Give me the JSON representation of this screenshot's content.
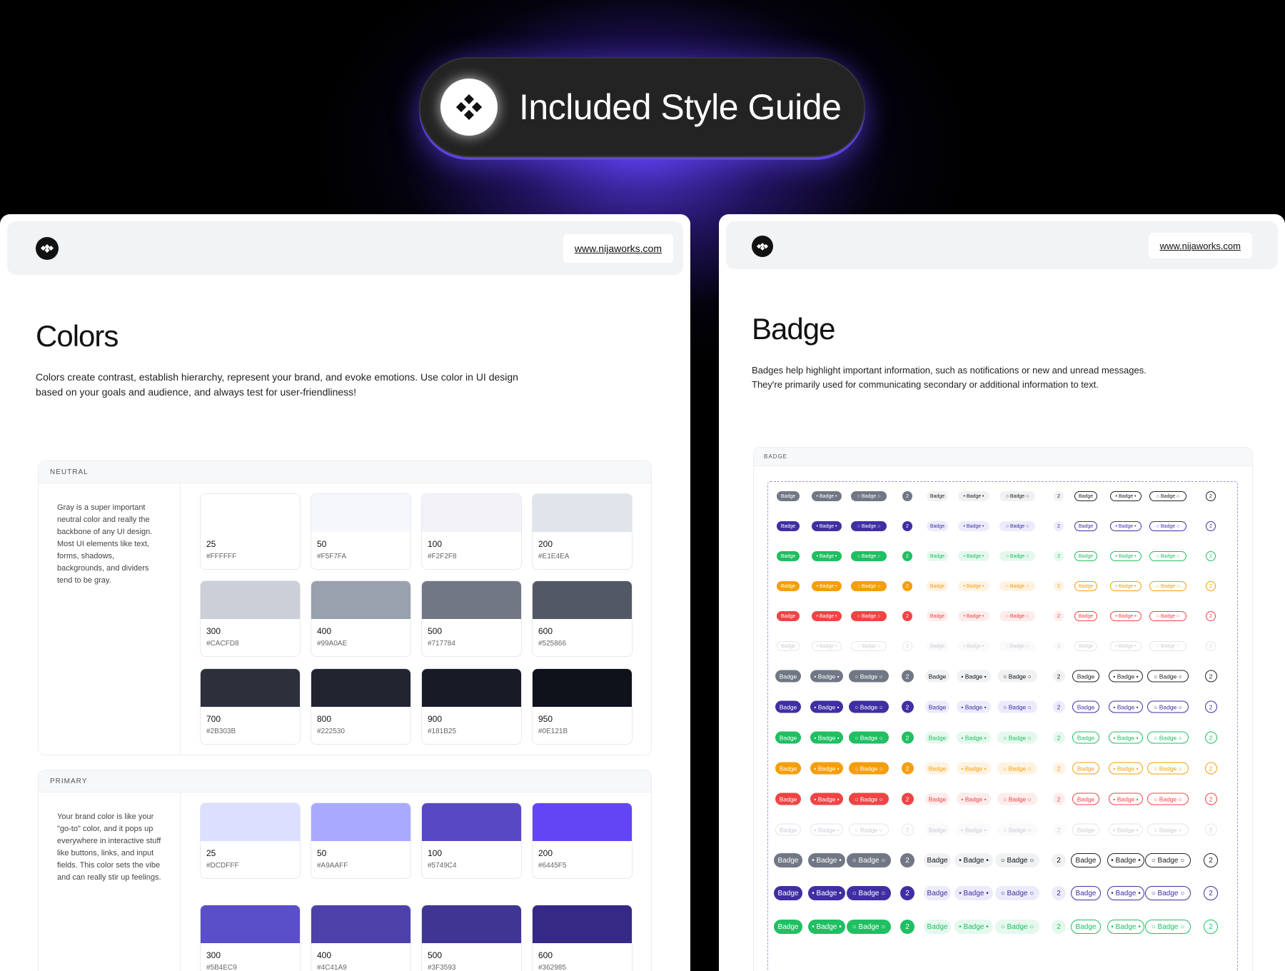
{
  "hero": {
    "title": "Included Style Guide"
  },
  "colors_card": {
    "url": "www.nijaworks.com",
    "title": "Colors",
    "description_line1": "Colors create contrast, establish hierarchy, represent your brand, and evoke emotions. Use color in UI design",
    "description_line2": "based on your goals and audience, and always test for user-friendliness!",
    "panels": [
      {
        "label": "NEUTRAL",
        "description": "Gray is a super important neutral color and really the backbone of any UI design. Most UI elements like text, forms, shadows, backgrounds, and dividers tend to be gray.",
        "swatches": [
          {
            "shade": "25",
            "hex": "#FFFFFF"
          },
          {
            "shade": "50",
            "hex": "#F5F7FA"
          },
          {
            "shade": "100",
            "hex": "#F2F2F8"
          },
          {
            "shade": "200",
            "hex": "#E1E4EA"
          },
          {
            "shade": "300",
            "hex": "#CACFD8"
          },
          {
            "shade": "400",
            "hex": "#99A0AE"
          },
          {
            "shade": "500",
            "hex": "#717784"
          },
          {
            "shade": "600",
            "hex": "#525866"
          },
          {
            "shade": "700",
            "hex": "#2B303B"
          },
          {
            "shade": "800",
            "hex": "#222530"
          },
          {
            "shade": "900",
            "hex": "#181B25"
          },
          {
            "shade": "950",
            "hex": "#0E121B"
          }
        ]
      },
      {
        "label": "PRIMARY",
        "description": "Your brand color is like your \"go-to\" color, and it pops up everywhere in interactive stuff like buttons, links, and input fields. This color sets the vibe and can really stir up feelings.",
        "swatches": [
          {
            "shade": "25",
            "hex": "#DCDFFF"
          },
          {
            "shade": "50",
            "hex": "#A9AAFF"
          },
          {
            "shade": "100",
            "hex": "#5749C4"
          },
          {
            "shade": "200",
            "hex": "#6445F5"
          },
          {
            "shade": "300",
            "hex": "#5B4EC9"
          },
          {
            "shade": "400",
            "hex": "#4C41A9"
          },
          {
            "shade": "500",
            "hex": "#3F3593"
          },
          {
            "shade": "600",
            "hex": "#362985"
          }
        ]
      }
    ]
  },
  "badge_card": {
    "url": "www.nijaworks.com",
    "title": "Badge",
    "description_line1": "Badges help highlight important information, such as notifications or new and unread messages.",
    "description_line2": "They're primarily used for communicating secondary or additional information to text.",
    "panel_label": "BADGE",
    "badge_text": "Badge",
    "count_text": "2",
    "palette": {
      "gray": "#717784",
      "purple": "#3F2FA3",
      "green": "#1FBF62",
      "orange": "#F59E0B",
      "red": "#EF4444",
      "disabled": "#D9DCE1"
    }
  }
}
